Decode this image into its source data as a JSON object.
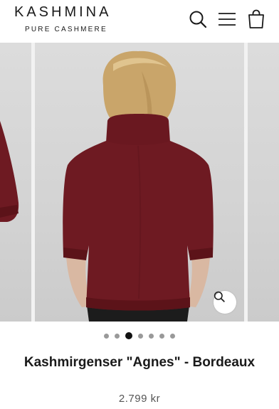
{
  "header": {
    "brand_name": "KASHMINA",
    "brand_tagline": "PURE CASHMERE",
    "icons": [
      "search-icon",
      "menu-icon",
      "shopping-bag-icon"
    ]
  },
  "gallery": {
    "slide_count": 7,
    "active_slide": 3,
    "zoom_icon": "zoom-icon",
    "colors": {
      "sweater": "#6e1a22",
      "background": "#d6d6d6"
    }
  },
  "product": {
    "title": "Kashmirgenser \"Agnes\" - Bordeaux",
    "price": "2.799 kr"
  }
}
